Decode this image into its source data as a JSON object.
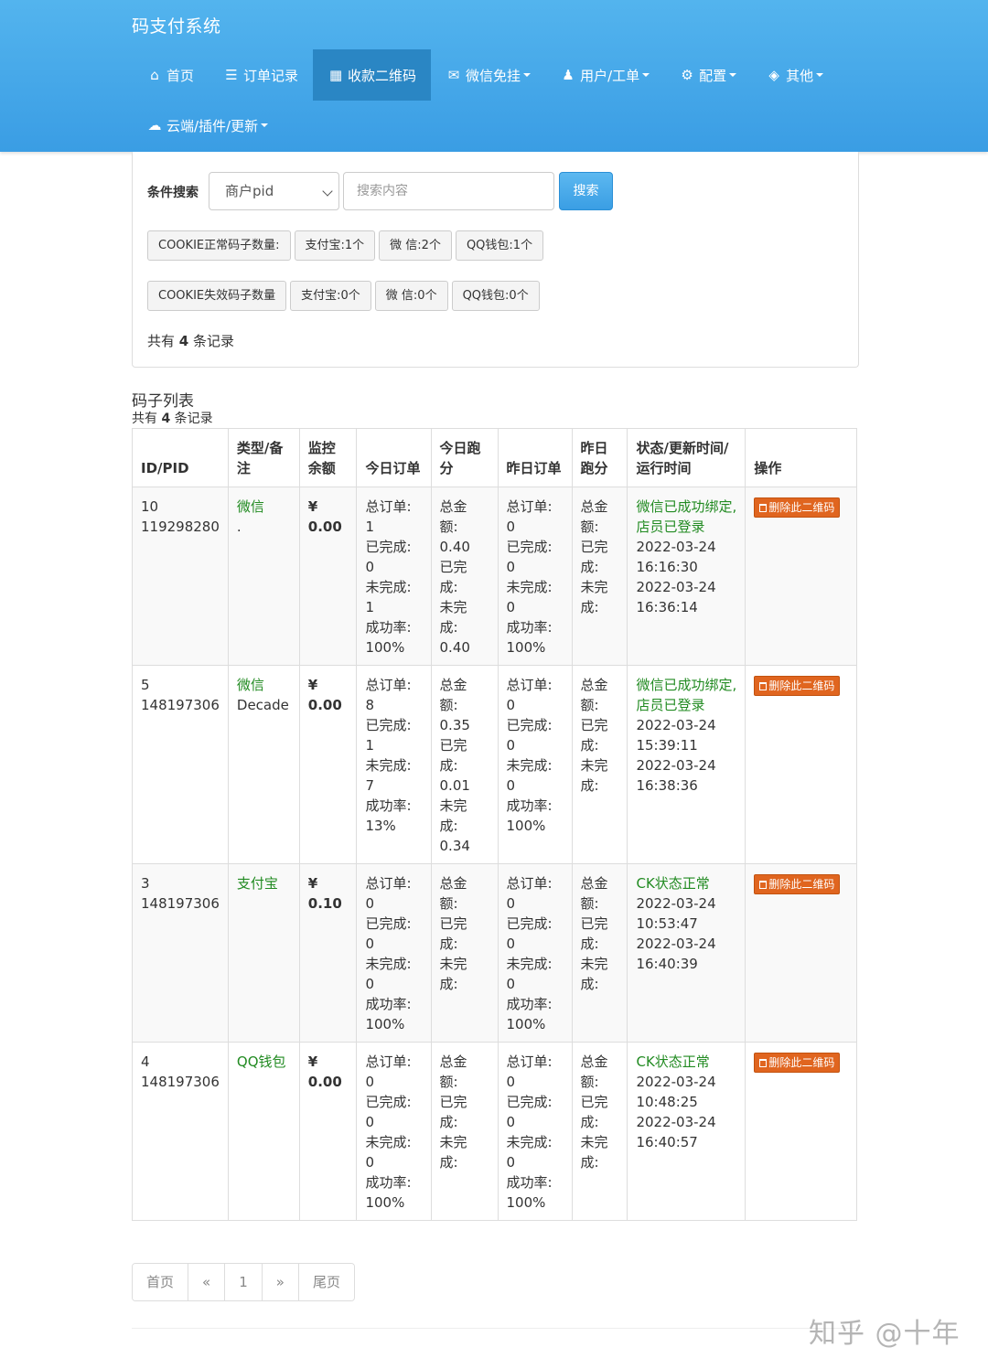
{
  "app": {
    "title": "码支付系统"
  },
  "nav": {
    "row1": [
      {
        "label": "首页",
        "icon": "home-icon",
        "glyph": "⌂",
        "dropdown": false,
        "active": false
      },
      {
        "label": "订单记录",
        "icon": "list-icon",
        "glyph": "☰",
        "dropdown": false,
        "active": false
      },
      {
        "label": "收款二维码",
        "icon": "qrcode-icon",
        "glyph": "▦",
        "dropdown": false,
        "active": true
      },
      {
        "label": "微信免挂",
        "icon": "wechat-icon",
        "glyph": "✉",
        "dropdown": true,
        "active": false
      },
      {
        "label": "用户/工单",
        "icon": "user-icon",
        "glyph": "♟",
        "dropdown": true,
        "active": false
      },
      {
        "label": "配置",
        "icon": "gear-icon",
        "glyph": "⚙",
        "dropdown": true,
        "active": false
      },
      {
        "label": "其他",
        "icon": "cube-icon",
        "glyph": "◈",
        "dropdown": true,
        "active": false
      }
    ],
    "row2": [
      {
        "label": "云端/插件/更新",
        "icon": "cloud-icon",
        "glyph": "☁",
        "dropdown": true,
        "active": false
      }
    ]
  },
  "search": {
    "label": "条件搜索",
    "field_selected": "商户pid",
    "placeholder": "搜索内容",
    "button": "搜索"
  },
  "cookie_ok": [
    "COOKIE正常码子数量:",
    "支付宝:1个",
    "微 信:2个",
    "QQ钱包:1个"
  ],
  "cookie_bad": [
    "COOKIE失效码子数量",
    "支付宝:0个",
    "微 信:0个",
    "QQ钱包:0个"
  ],
  "summary": {
    "prefix": "共有 ",
    "count": "4",
    "suffix": " 条记录"
  },
  "list": {
    "title": "码子列表",
    "prefix": "共有 ",
    "count": "4",
    "suffix": " 条记录"
  },
  "table": {
    "headers": [
      "ID/PID",
      "类型/备注",
      "监控余额",
      "今日订单",
      "今日跑分",
      "昨日订单",
      "昨日跑分",
      "状态/更新时间/运行时间",
      "操作"
    ],
    "rows": [
      {
        "id": "10",
        "pid": "119298280",
        "type": "微信",
        "note": ".",
        "currency": "¥",
        "balance": "0.00",
        "today_orders": [
          "总订单:",
          "1",
          "已完成:",
          "0",
          "未完成:",
          "1",
          "成功率:",
          "100%"
        ],
        "today_score": [
          "总金",
          "额:",
          "0.40",
          "已完",
          "成:",
          "未完",
          "成:",
          "0.40"
        ],
        "yday_orders": [
          "总订单:",
          "0",
          "已完成:",
          "0",
          "未完成:",
          "0",
          "成功率:",
          "100%"
        ],
        "yday_score": [
          "总金",
          "额:",
          "已完",
          "成:",
          "未完",
          "成:"
        ],
        "status": [
          "微信已成功绑定,",
          "店员已登录"
        ],
        "times": [
          "2022-03-24",
          "16:16:30",
          "2022-03-24",
          "16:36:14"
        ],
        "action": "删除此二维码"
      },
      {
        "id": "5",
        "pid": "148197306",
        "type": "微信",
        "note": "Decade",
        "currency": "¥",
        "balance": "0.00",
        "today_orders": [
          "总订单:",
          "8",
          "已完成:",
          "1",
          "未完成:",
          "7",
          "成功率:",
          "13%"
        ],
        "today_score": [
          "总金",
          "额:",
          "0.35",
          "已完",
          "成:",
          "0.01",
          "未完",
          "成:",
          "0.34"
        ],
        "yday_orders": [
          "总订单:",
          "0",
          "已完成:",
          "0",
          "未完成:",
          "0",
          "成功率:",
          "100%"
        ],
        "yday_score": [
          "总金",
          "额:",
          "已完",
          "成:",
          "未完",
          "成:"
        ],
        "status": [
          "微信已成功绑定,",
          "店员已登录"
        ],
        "times": [
          "2022-03-24",
          "15:39:11",
          "2022-03-24",
          "16:38:36"
        ],
        "action": "删除此二维码"
      },
      {
        "id": "3",
        "pid": "148197306",
        "type": "支付宝",
        "note": "",
        "currency": "¥",
        "balance": "0.10",
        "today_orders": [
          "总订单:",
          "0",
          "已完成:",
          "0",
          "未完成:",
          "0",
          "成功率:",
          "100%"
        ],
        "today_score": [
          "总金",
          "额:",
          "已完",
          "成:",
          "未完",
          "成:"
        ],
        "yday_orders": [
          "总订单:",
          "0",
          "已完成:",
          "0",
          "未完成:",
          "0",
          "成功率:",
          "100%"
        ],
        "yday_score": [
          "总金",
          "额:",
          "已完",
          "成:",
          "未完",
          "成:"
        ],
        "status": [
          "CK状态正常"
        ],
        "times": [
          "2022-03-24",
          "10:53:47",
          "2022-03-24",
          "16:40:39"
        ],
        "action": "删除此二维码"
      },
      {
        "id": "4",
        "pid": "148197306",
        "type": "QQ钱包",
        "note": "",
        "currency": "¥",
        "balance": "0.00",
        "today_orders": [
          "总订单:",
          "0",
          "已完成:",
          "0",
          "未完成:",
          "0",
          "成功率:",
          "100%"
        ],
        "today_score": [
          "总金",
          "额:",
          "已完",
          "成:",
          "未完",
          "成:"
        ],
        "yday_orders": [
          "总订单:",
          "0",
          "已完成:",
          "0",
          "未完成:",
          "0",
          "成功率:",
          "100%"
        ],
        "yday_score": [
          "总金",
          "额:",
          "已完",
          "成:",
          "未完",
          "成:"
        ],
        "status": [
          "CK状态正常"
        ],
        "times": [
          "2022-03-24",
          "10:48:25",
          "2022-03-24",
          "16:40:57"
        ],
        "action": "删除此二维码"
      }
    ]
  },
  "pagination": [
    "首页",
    "«",
    "1",
    "»",
    "尾页"
  ],
  "watermark": "知乎 @十年",
  "colors": {
    "nav_bg": "#3a9de4",
    "nav_active": "#2a86c4",
    "status_green": "#228b22",
    "delete_btn": "#e0651f"
  }
}
